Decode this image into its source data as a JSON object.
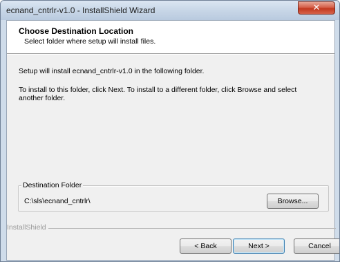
{
  "window": {
    "title": "ecnand_cntrlr-v1.0 - InstallShield Wizard",
    "close_icon": "✕"
  },
  "header": {
    "title": "Choose Destination Location",
    "subtitle": "Select folder where setup will install files."
  },
  "body": {
    "install_text": "Setup will install ecnand_cntrlr-v1.0 in the following folder.",
    "instruction_text": "To install to this folder, click Next. To install to a different folder, click Browse and select another folder."
  },
  "destination": {
    "group_label": "Destination Folder",
    "path": "C:\\sls\\ecnand_cntrlr\\",
    "browse_label": "Browse..."
  },
  "footer": {
    "brand": "InstallShield",
    "back_label": "< Back",
    "next_label": "Next >",
    "cancel_label": "Cancel"
  },
  "icons": {
    "close": "close-icon"
  },
  "colors": {
    "close_button": "#c2391f",
    "default_button_border": "#3c7fb1"
  }
}
